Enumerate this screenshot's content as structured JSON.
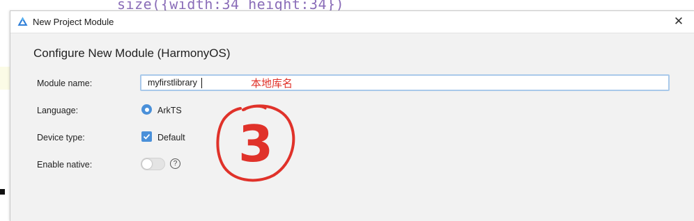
{
  "background": {
    "code_snippet": "size({width:34 height:34})"
  },
  "dialog": {
    "title": "New Project Module",
    "close_glyph": "✕",
    "heading": "Configure New Module (HarmonyOS)",
    "fields": {
      "module_name": {
        "label": "Module name:",
        "value": "myfirstlibrary"
      },
      "language": {
        "label": "Language:",
        "option": "ArkTS",
        "selected": true
      },
      "device_type": {
        "label": "Device type:",
        "option": "Default",
        "checked": true
      },
      "enable_native": {
        "label": "Enable native:",
        "enabled": false,
        "help_glyph": "?"
      }
    }
  },
  "annotations": {
    "note": "本地库名",
    "step_marker": "3",
    "color": "#e0322a"
  },
  "colors": {
    "accent": "#4a90d9",
    "input_focus_border": "#a9c9ea",
    "dialog_bg": "#f2f2f2"
  },
  "icons": {
    "app": "deveco-triangle-icon",
    "close": "close-icon",
    "help": "help-circle-icon",
    "check": "check-icon"
  }
}
